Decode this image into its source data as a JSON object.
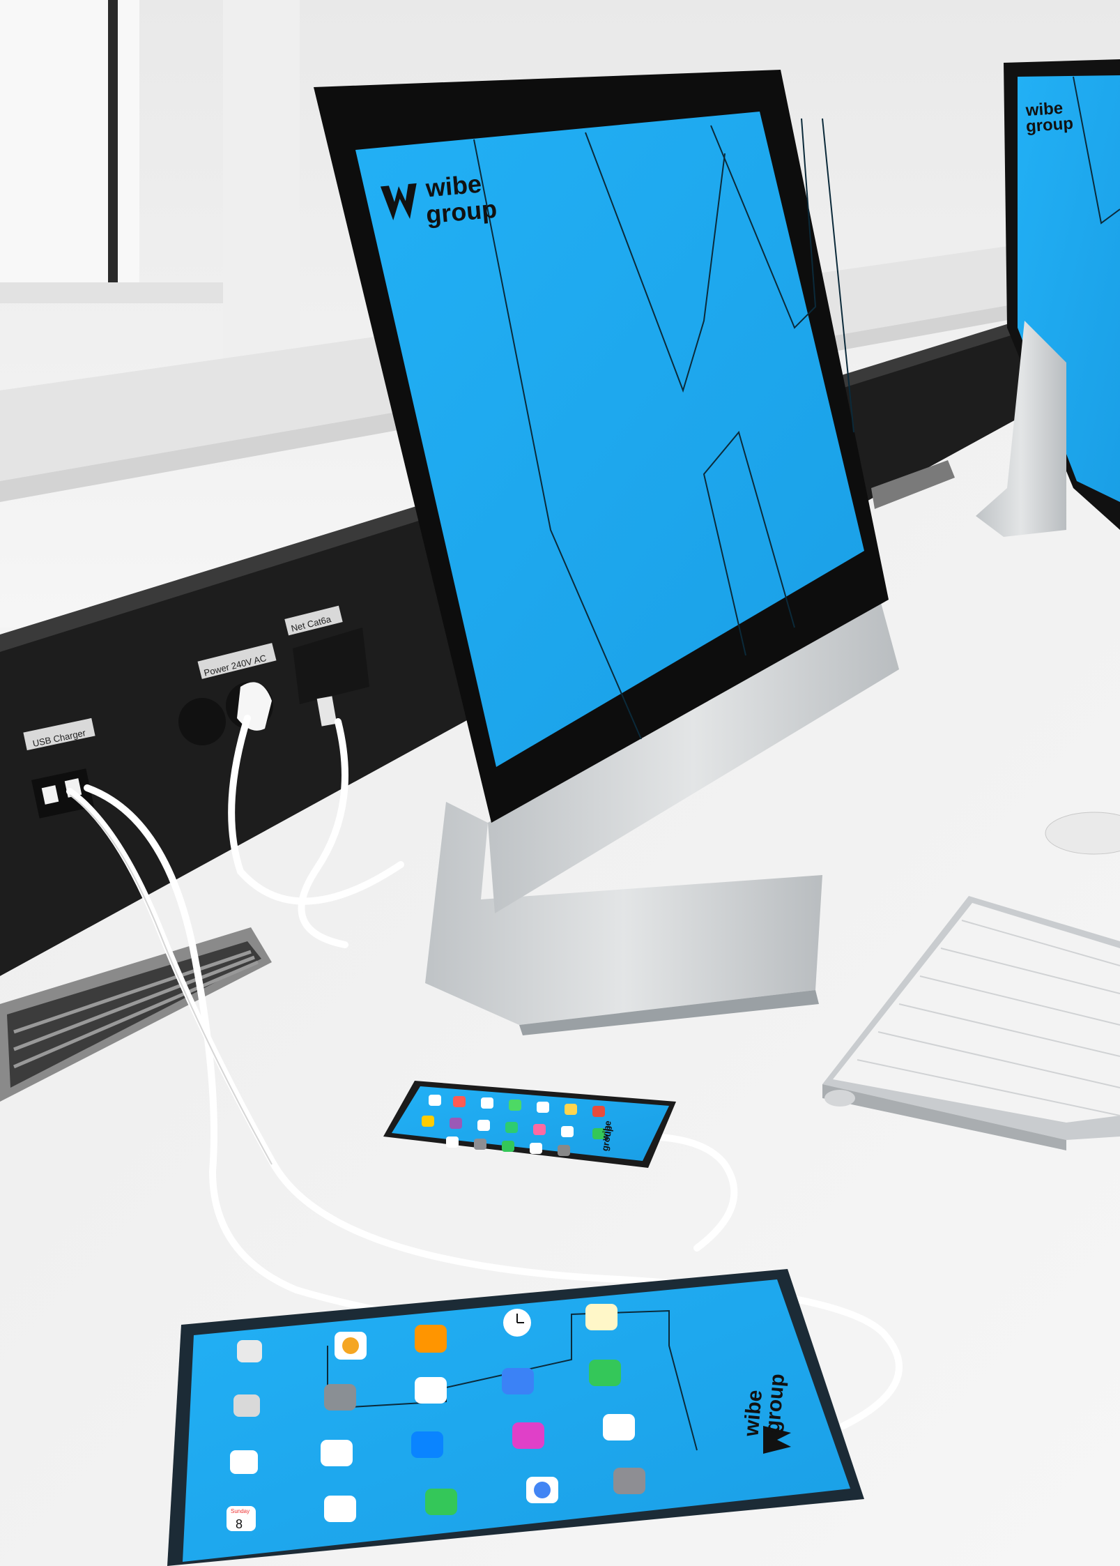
{
  "scene": {
    "type": "photo",
    "colors": {
      "wall": "#eeeeee",
      "desk": "#f2f2f2",
      "screen_blue": "#1aa8ef",
      "trunking": "#1d1d1d",
      "aluminium": "#cfd2d4",
      "cable": "#ffffff"
    }
  },
  "trunking": {
    "labels": {
      "usb": "USB Charger",
      "power": "Power 240V AC",
      "net": "Net Cat6a"
    }
  },
  "monitor_main": {
    "brand_wordmark": {
      "line1": "wibe",
      "line2": "group"
    },
    "logo_icon": "w-logo-icon"
  },
  "monitor_right": {
    "brand_wordmark": {
      "line1": "wibe",
      "line2": "group"
    }
  },
  "phone": {
    "brand_wordmark": {
      "line1": "wibe",
      "line2": "group"
    },
    "app_icons": [
      "clock-icon",
      "messages-icon",
      "mail-icon",
      "camera-icon",
      "maps-icon",
      "appstore-icon",
      "settings-icon",
      "photos-icon",
      "chrome-icon",
      "notes-icon",
      "music-icon",
      "calendar-icon",
      "phone-icon"
    ]
  },
  "tablet": {
    "brand_wordmark": {
      "line1": "wibe",
      "line2": "group"
    },
    "calendar_icon": {
      "month": "Sunday",
      "day": "8"
    },
    "app_icons": [
      "calendar-icon",
      "camera-icon",
      "files-icon",
      "photos-icon",
      "books-icon",
      "grey-app-icon",
      "clapper-icon",
      "docs-icon",
      "clock-icon",
      "messenger-icon",
      "appstore-icon",
      "face-icon",
      "mail-icon",
      "itunes-icon",
      "chrome-icon",
      "notes-icon",
      "messages-icon",
      "maps-icon",
      "settings-icon"
    ]
  }
}
